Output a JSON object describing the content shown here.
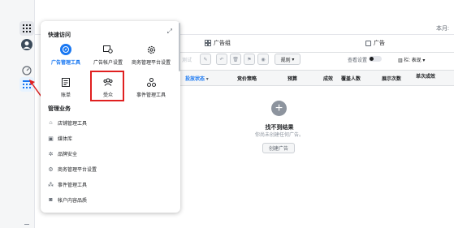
{
  "page": {
    "range_label": "本月:",
    "tabs": [
      {
        "label": "广告组"
      },
      {
        "label": "广告"
      }
    ],
    "toolbar": {
      "left_clip": "测试",
      "rules_label": "规则",
      "view_settings_label": "查看设置",
      "columns_label": "栏: 表现"
    },
    "table_headers": [
      "投放状态",
      "竞价策略",
      "预算",
      "成效",
      "覆盖人数",
      "展示次数",
      "单次成效"
    ],
    "empty_state": {
      "title": "找不到结果",
      "description": "你尚未创建任何广告。",
      "button": "创建广告"
    }
  },
  "popup": {
    "quick_access_title": "快速访问",
    "quick_access": [
      {
        "label": "广告管理工具",
        "icon": "compass-icon",
        "active": true
      },
      {
        "label": "广告帐户设置",
        "icon": "account-settings-icon",
        "active": false
      },
      {
        "label": "商务管理平台设置",
        "icon": "gear-icon",
        "active": false
      },
      {
        "label": "账单",
        "icon": "billing-icon",
        "active": false
      },
      {
        "label": "受众",
        "icon": "audience-icon",
        "active": false
      },
      {
        "label": "事件管理工具",
        "icon": "events-icon",
        "active": false
      }
    ],
    "manage_title": "管理业务",
    "manage_items": [
      {
        "label": "店铺管理工具",
        "icon": "shop-icon"
      },
      {
        "label": "媒体库",
        "icon": "media-icon"
      },
      {
        "label": "品牌安全",
        "icon": "brand-safety-icon"
      },
      {
        "label": "商务管理平台设置",
        "icon": "gear-icon"
      },
      {
        "label": "事件管理工具",
        "icon": "events-icon"
      },
      {
        "label": "帐户内容品质",
        "icon": "quality-icon"
      }
    ]
  },
  "colors": {
    "accent": "#1877f2",
    "highlight": "#e02020"
  }
}
